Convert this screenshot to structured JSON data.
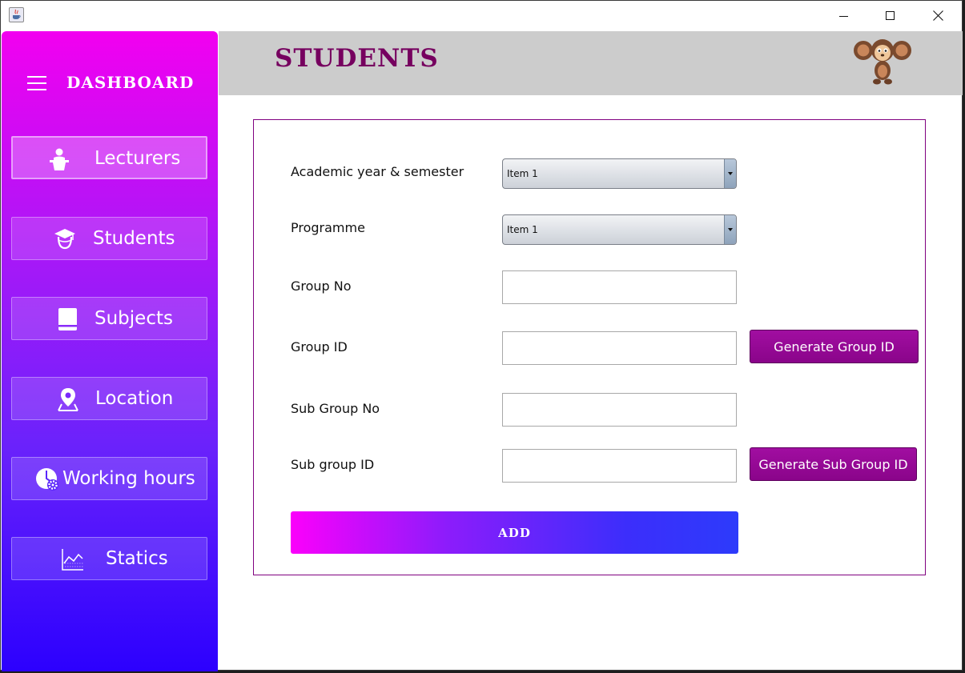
{
  "window": {
    "controls": {
      "minimize_icon": "minimize-icon",
      "maximize_icon": "maximize-icon",
      "close_icon": "close-icon"
    }
  },
  "sidebar": {
    "title": "DASHBOARD",
    "items": [
      {
        "label": "Lecturers",
        "icon": "lecturer-podium-icon",
        "active": true
      },
      {
        "label": "Students",
        "icon": "graduation-cap-icon",
        "active": false
      },
      {
        "label": "Subjects",
        "icon": "book-icon",
        "active": false
      },
      {
        "label": "Location",
        "icon": "location-pin-icon",
        "active": false
      },
      {
        "label": "Working hours",
        "icon": "clock-gear-icon",
        "active": false
      },
      {
        "label": "Statics",
        "icon": "line-chart-icon",
        "active": false
      }
    ]
  },
  "header": {
    "title": "STUDENTS",
    "avatar_icon": "cheburashka-avatar"
  },
  "form": {
    "academic_year": {
      "label": "Academic year & semester",
      "value": "Item 1"
    },
    "programme": {
      "label": "Programme",
      "value": "Item 1"
    },
    "group_no": {
      "label": "Group No",
      "value": ""
    },
    "group_id": {
      "label": "Group ID",
      "value": "",
      "button": "Generate Group ID"
    },
    "sub_group_no": {
      "label": "Sub Group No",
      "value": ""
    },
    "sub_group_id": {
      "label": "Sub group ID",
      "value": "",
      "button": "Generate Sub Group ID"
    },
    "add_button": "ADD"
  },
  "colors": {
    "accent_purple": "#800080",
    "title_color": "#76005f",
    "sidebar_top": "#f200f0",
    "sidebar_bottom": "#2c00fe",
    "header_bg": "#cccccc"
  }
}
